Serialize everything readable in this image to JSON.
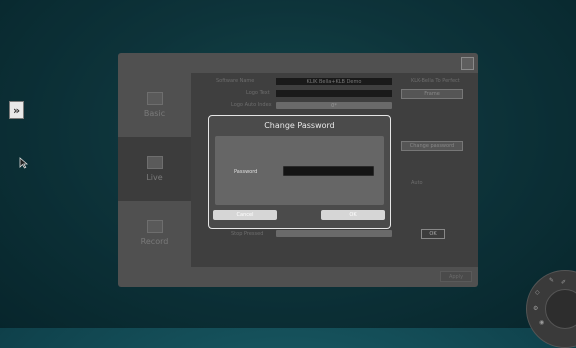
{
  "side_toggle": {
    "glyph": "»"
  },
  "tabs": [
    {
      "label": "Basic",
      "icon": "monitor-icon"
    },
    {
      "label": "Live",
      "icon": "broadcast-icon"
    },
    {
      "label": "Record",
      "icon": "record-icon"
    }
  ],
  "basic": {
    "software_name_label": "Software Name",
    "software_name_value": "KLIK Bella+KLB Demo",
    "right_top_text": "KLK-Bella To Perfect",
    "right_sub_button": "Frame",
    "logo_text_label": "Logo Text",
    "logo_auto_label": "Logo Auto Index",
    "logo_auto_value": "0*",
    "right_mid_button": "Change password",
    "right_auto_label": "Auto",
    "bottom_label": "Stop Pressed",
    "ok_button": "OK",
    "apply_button": "Apply"
  },
  "dialog": {
    "title": "Change Password",
    "password_label": "Password",
    "password_value": "",
    "cancel_label": "Cancel",
    "ok_label": "OK"
  }
}
